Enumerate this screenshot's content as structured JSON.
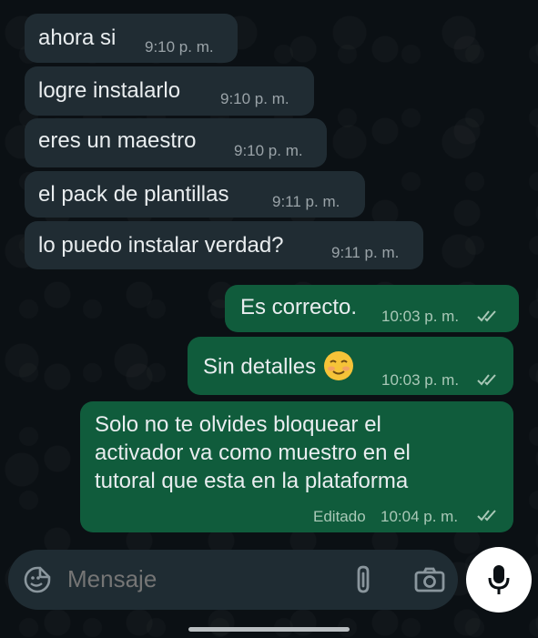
{
  "messages": [
    {
      "direction": "in",
      "text": "ahora si",
      "time": "9:10 p. m."
    },
    {
      "direction": "in",
      "text": "logre instalarlo",
      "time": "9:10 p. m."
    },
    {
      "direction": "in",
      "text": "eres un maestro",
      "time": "9:10 p. m."
    },
    {
      "direction": "in",
      "text": "el pack de plantillas",
      "time": "9:11 p. m."
    },
    {
      "direction": "in",
      "text": "lo puedo instalar verdad?",
      "time": "9:11 p. m."
    },
    {
      "direction": "out",
      "text": "Es correcto.",
      "time": "10:03 p. m.",
      "status": "read"
    },
    {
      "direction": "out",
      "text": "Sin detalles",
      "emoji": "smiling-face-emoji",
      "time": "10:03 p. m.",
      "status": "read"
    },
    {
      "direction": "out",
      "lines": [
        "Solo no te olvides bloquear el",
        "activador va como muestro en el",
        "tutoral que esta en la plataforma"
      ],
      "edited_label": "Editado",
      "time": "10:04 p. m.",
      "status": "read"
    }
  ],
  "composer": {
    "placeholder": "Mensaje",
    "icons": [
      "emoji-sticker-icon",
      "attach-icon",
      "camera-icon"
    ]
  },
  "mic_button": {
    "icon": "mic-icon"
  },
  "colors": {
    "background": "#0b1014",
    "incoming_bubble": "#202c33",
    "outgoing_bubble": "#105c3c",
    "text": "#e9edef",
    "meta_text": "#9aa3a8",
    "composer": "#1f2c33"
  }
}
